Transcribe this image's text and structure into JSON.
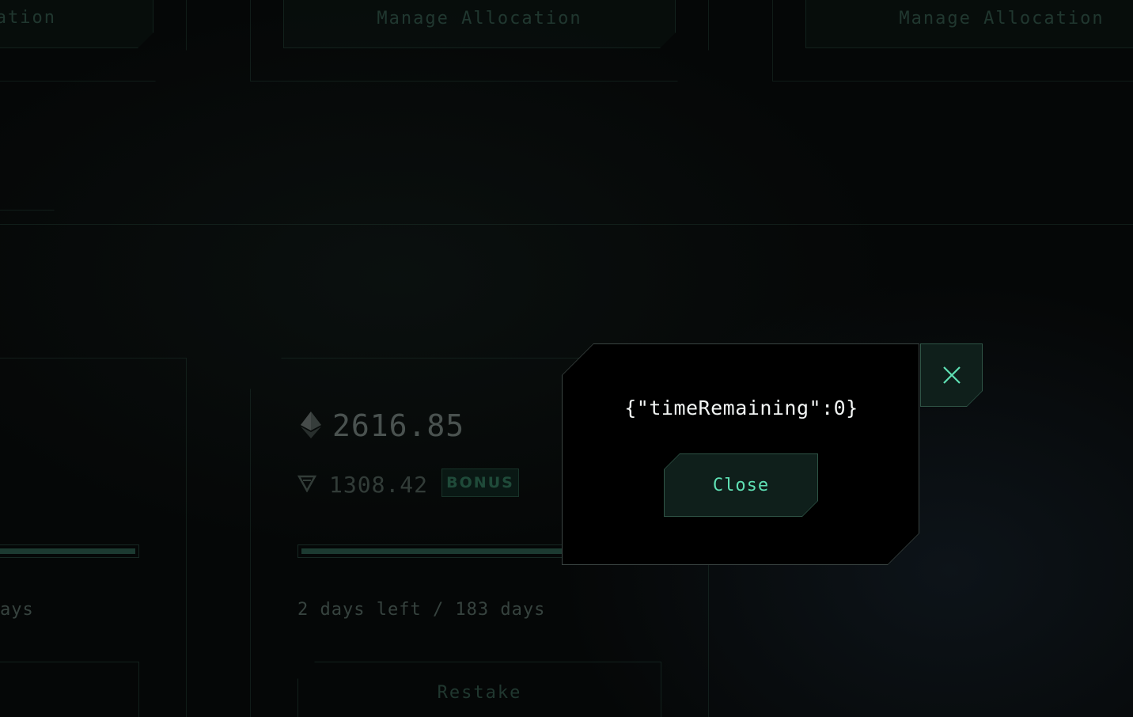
{
  "background": {
    "allocation_buttons": [
      {
        "label": "ation"
      },
      {
        "label": "Manage Allocation"
      },
      {
        "label": "Manage Allocation"
      }
    ],
    "stake_card": {
      "eth_amount": "2616.85",
      "bonus_amount": "1308.42",
      "bonus_badge": "BONUS",
      "progress_fraction": 0.989,
      "days_text": "2 days left / 183 days",
      "action_label": "Restake"
    },
    "left_card": {
      "days_text_fragment": "ays",
      "progress_fraction": 0.99
    }
  },
  "modal": {
    "message": "{\"timeRemaining\":0}",
    "close_label": "Close"
  },
  "icons": {
    "eth": "ethereum-icon",
    "bonus": "triangle-token-icon",
    "close": "close-icon"
  },
  "colors": {
    "accent": "#5fe0b4",
    "panel_border": "#2f5446",
    "background": "#050707"
  }
}
